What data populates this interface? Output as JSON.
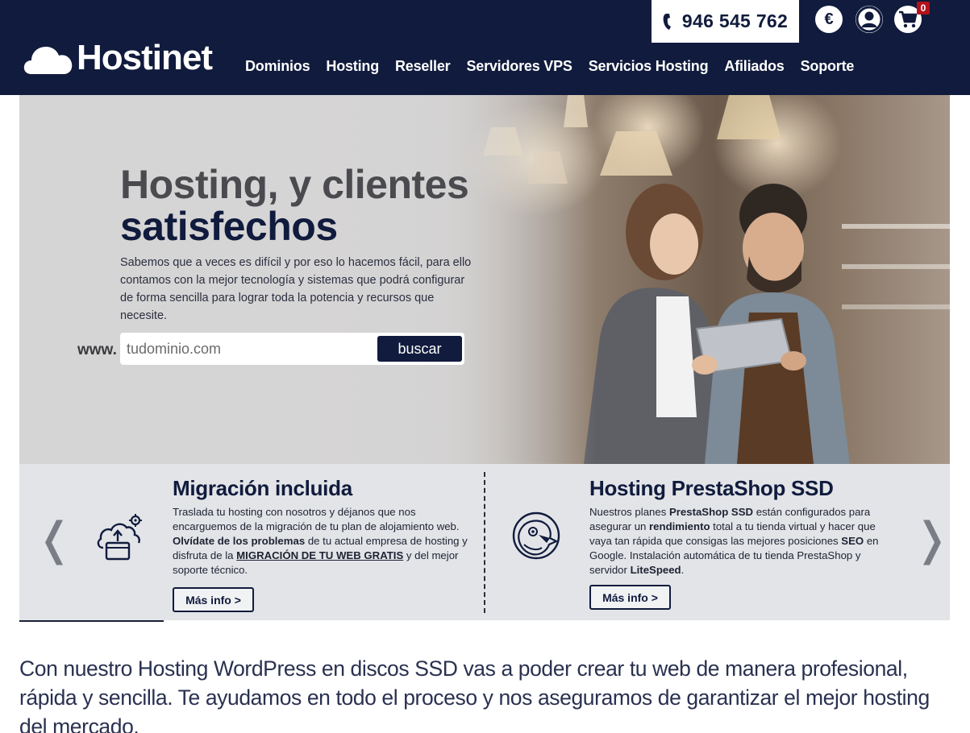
{
  "header": {
    "phone": "946 545 762",
    "currency_symbol": "€",
    "cart_count": "0",
    "logo_text": "Hostinet",
    "nav": [
      {
        "label": "Dominios"
      },
      {
        "label": "Hosting"
      },
      {
        "label": "Reseller"
      },
      {
        "label": "Servidores VPS"
      },
      {
        "label": "Servicios Hosting"
      },
      {
        "label": "Afiliados"
      },
      {
        "label": "Soporte"
      }
    ]
  },
  "hero": {
    "title_line1": "Hosting, y clientes",
    "title_line2": "satisfechos",
    "description": "Sabemos que a veces es difícil y por eso lo hacemos fácil, para ello contamos con la mejor tecnología y sistemas que podrá configurar de forma sencilla para lograr toda la potencia y recursos que necesite.",
    "search": {
      "prefix": "www.",
      "placeholder": "tudominio.com",
      "button_label": "buscar"
    }
  },
  "features": {
    "prev_arrow": "❬",
    "next_arrow": "❭",
    "items": [
      {
        "icon": "cloud-migration-icon",
        "title": "Migración incluida",
        "body_parts": {
          "p1": "Traslada tu hosting con nosotros y déjanos que nos encarguemos de la migración de tu plan de alojamiento web. ",
          "b1": "Olvídate de los problemas",
          "p2": " de tu actual empresa de hosting y disfruta de la ",
          "u1": "MIGRACIÓN DE TU WEB GRATIS",
          "p3": " y del mejor soporte técnico."
        },
        "button_label": "Más info >"
      },
      {
        "icon": "puffin-icon",
        "title": "Hosting PrestaShop SSD",
        "body_parts": {
          "p1": "Nuestros  planes ",
          "b1": "PrestaShop SSD",
          "p2": " están configurados para asegurar un ",
          "b2": "rendimiento",
          "p3": " total a tu tienda virtual y hacer que vaya tan rápida que consigas las mejores posiciones ",
          "b3": "SEO",
          "p4": " en Google. Instalación automática de tu tienda PrestaShop y servidor ",
          "b4": "LiteSpeed",
          "p5": "."
        },
        "button_label": "Más info >"
      }
    ]
  },
  "tagline": "Con nuestro Hosting WordPress en discos SSD vas a poder crear tu web de manera profesional, rápida y sencilla. Te ayudamos en todo el proceso y nos aseguramos de garantizar el mejor hosting del mercado.",
  "colors": {
    "brand_navy": "#101b3d",
    "badge_red": "#b3121b",
    "features_bg": "#e2e4e7"
  }
}
